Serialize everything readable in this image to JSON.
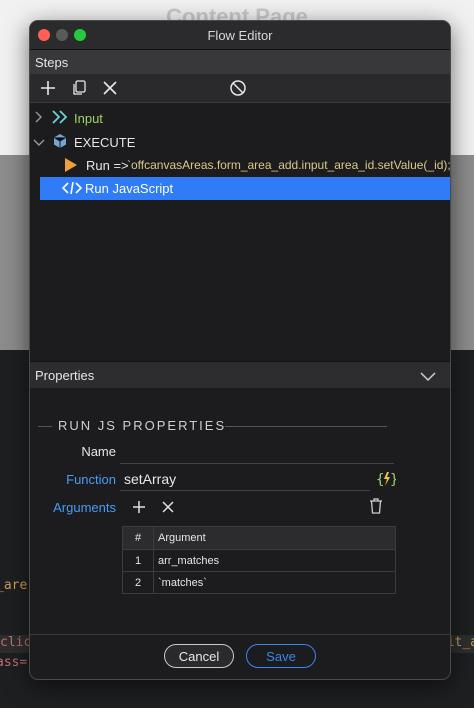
{
  "background": {
    "page_title": "Content Page",
    "code_line1": "_are",
    "code_line2": "clic",
    "code_line2_right": "it_a",
    "code_line3": "ass="
  },
  "window": {
    "title": "Flow Editor"
  },
  "steps": {
    "header": "Steps",
    "toolbar": {
      "add_icon": "plus-icon",
      "duplicate_icon": "copy-icon",
      "delete_icon": "x-icon",
      "disable_icon": "no-entry-icon"
    },
    "tree": [
      {
        "label": "Input",
        "icon": "chevrons-right-icon",
        "color": "#9fd36a"
      },
      {
        "label": "EXECUTE",
        "icon": "cube-icon"
      },
      {
        "label": "Run =>",
        "code": "`offcanvasAreas.form_area_add.input_area_id.setValue(_id);o",
        "icon": "play-icon"
      },
      {
        "label": "Run JavaScript",
        "icon": "code-icon",
        "selected": true
      }
    ]
  },
  "properties": {
    "header": "Properties",
    "group_title": "RUN JS PROPERTIES",
    "name_label": "Name",
    "name_value": "",
    "function_label": "Function",
    "function_value": "setArray",
    "arguments_label": "Arguments",
    "table": {
      "headers": [
        "#",
        "Argument"
      ],
      "rows": [
        {
          "num": "1",
          "arg": "arr_matches"
        },
        {
          "num": "2",
          "arg": "`matches`"
        }
      ]
    }
  },
  "footer": {
    "cancel_label": "Cancel",
    "save_label": "Save"
  },
  "colors": {
    "accent": "#2f7cf6",
    "link": "#4a9bf5",
    "input_green": "#9fd36a"
  }
}
